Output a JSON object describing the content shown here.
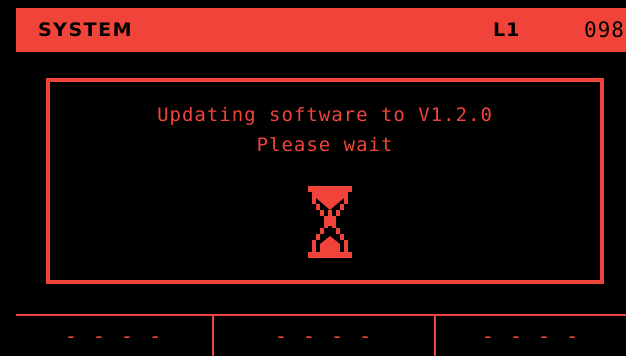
{
  "header": {
    "title": "SYSTEM",
    "layer": "L1",
    "program": "098"
  },
  "dialog": {
    "line1": "Updating software to V1.2.0",
    "line2": "Please wait",
    "icon": "hourglass-icon"
  },
  "softkeys": [
    {
      "label": "- - - -"
    },
    {
      "label": "- - - -"
    },
    {
      "label": "- - - -"
    }
  ],
  "colors": {
    "accent": "#f0443a",
    "background": "#000000",
    "header_text": "#000000"
  }
}
